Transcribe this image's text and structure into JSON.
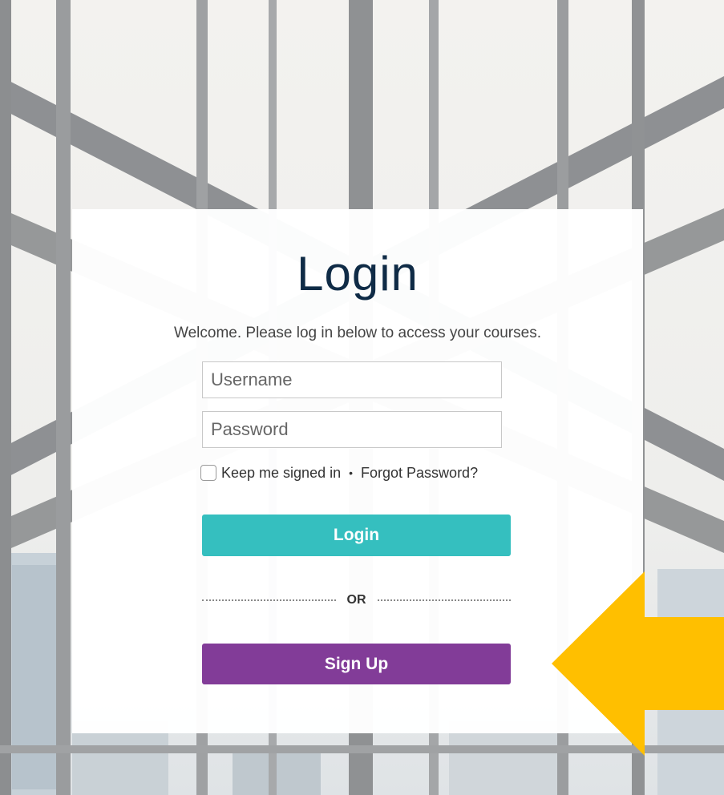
{
  "login": {
    "title": "Login",
    "subtitle": "Welcome. Please log in below to access your courses.",
    "username_placeholder": "Username",
    "password_placeholder": "Password",
    "keep_signed_in": "Keep me signed in",
    "separator_dot": "•",
    "forgot_password": "Forgot Password?",
    "login_button": "Login",
    "or_text": "OR",
    "signup_button": "Sign Up"
  },
  "colors": {
    "title": "#0f2b46",
    "login_button": "#35bfbf",
    "signup_button": "#823c98",
    "arrow": "#ffbf00"
  },
  "icons": {
    "annotation": "arrow-left-icon"
  }
}
